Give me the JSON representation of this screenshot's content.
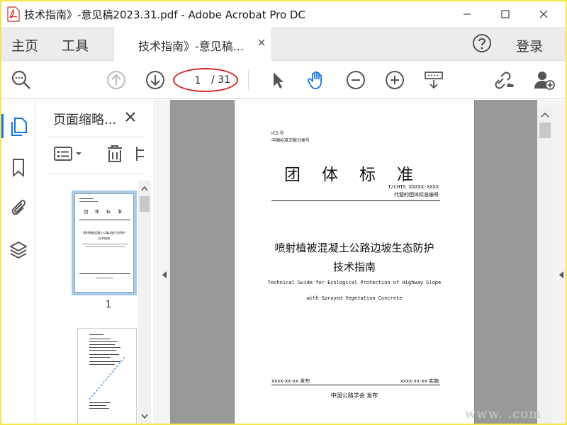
{
  "window": {
    "title": "技术指南》-意见稿2023.31.pdf - Adobe Acrobat Pro DC",
    "accent_color": "#1473e6"
  },
  "tabs": {
    "home": "主页",
    "tools": "工具",
    "document": "技术指南》-意见稿...",
    "login": "登录"
  },
  "toolbar": {
    "current_page": "1",
    "total_pages": "/ 31",
    "icons": [
      "zoom-search-icon",
      "page-up-icon",
      "page-down-icon",
      "select-cursor-icon",
      "hand-icon",
      "zoom-out-icon",
      "zoom-in-icon",
      "fit-page-icon",
      "share-link-icon",
      "add-user-icon"
    ]
  },
  "thumbnails_panel": {
    "title": "页面缩略...",
    "thumb1_number": "1",
    "thumb1_title": "团 体 标 准",
    "thumb1_sub1": "喷射植被混凝土公路边坡生态防护",
    "thumb1_sub2": "技术指南"
  },
  "document": {
    "ics": "ICS 号",
    "classification": "中国标准文献分类号",
    "header_title": "团体标准",
    "std_number": "T/CHTS XXXXX-XXXX",
    "replaced_std": "代替的团体标准编号",
    "cn_title_line1": "喷射植被混凝土公路边坡生态防护",
    "cn_title_line2": "技术指南",
    "en_title_line1": "Technical Guide for Ecological Protection of Highway Slope",
    "en_title_line2": "with Sprayed Vegetation Concrete",
    "publish_date": "xxxx-xx-xx 发布",
    "implement_date": "xxxx-xx-xx 实施",
    "publisher": "中国公路学会  发布"
  },
  "watermark": "www.      .com"
}
